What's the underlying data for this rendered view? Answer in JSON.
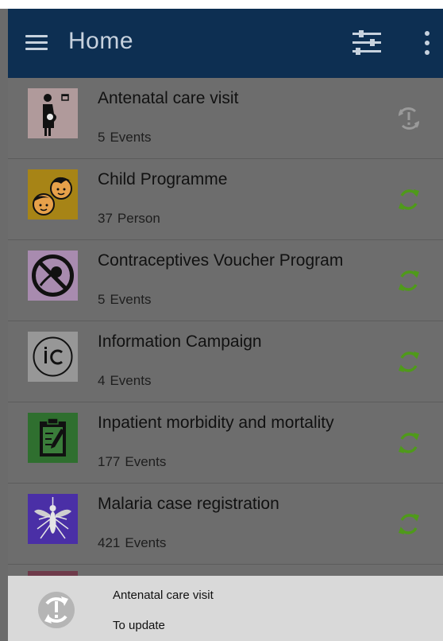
{
  "appbar": {
    "title": "Home",
    "background": "#0d2f52",
    "menu_icon": "hamburger-menu-icon",
    "filter_icon": "filter-sliders-icon",
    "more_icon": "more-vertical-icon"
  },
  "programs": [
    {
      "name": "Antenatal care visit",
      "count": "5",
      "unit": "Events",
      "tile_color": "#f5c9cc",
      "icon": "pregnant-woman-icon",
      "sync_state": "pending"
    },
    {
      "name": "Child Programme",
      "count": "37",
      "unit": "Person",
      "tile_color": "#f2b619",
      "icon": "children-faces-icon",
      "sync_state": "synced"
    },
    {
      "name": "Contraceptives Voucher Program",
      "count": "5",
      "unit": "Events",
      "tile_color": "#e7c6f0",
      "icon": "no-pregnancy-icon",
      "sync_state": "synced"
    },
    {
      "name": "Information Campaign",
      "count": "4",
      "unit": "Events",
      "tile_color": "#d8d8d8",
      "icon": "ic-campaign-icon",
      "sync_state": "synced"
    },
    {
      "name": "Inpatient morbidity and mortality",
      "count": "177",
      "unit": "Events",
      "tile_color": "#4ca64c",
      "icon": "clipboard-icon",
      "sync_state": "synced"
    },
    {
      "name": "Malaria case registration",
      "count": "421",
      "unit": "Events",
      "tile_color": "#5a3ad1",
      "icon": "mosquito-icon",
      "sync_state": "synced"
    }
  ],
  "snackbar": {
    "title": "Antenatal care visit",
    "subtitle": "To update",
    "icon": "sync-pending-icon"
  },
  "colors": {
    "sync_green": "#4f9a1a",
    "pending_gray": "#9a9a9a",
    "scrim": "#6d6d6d"
  }
}
